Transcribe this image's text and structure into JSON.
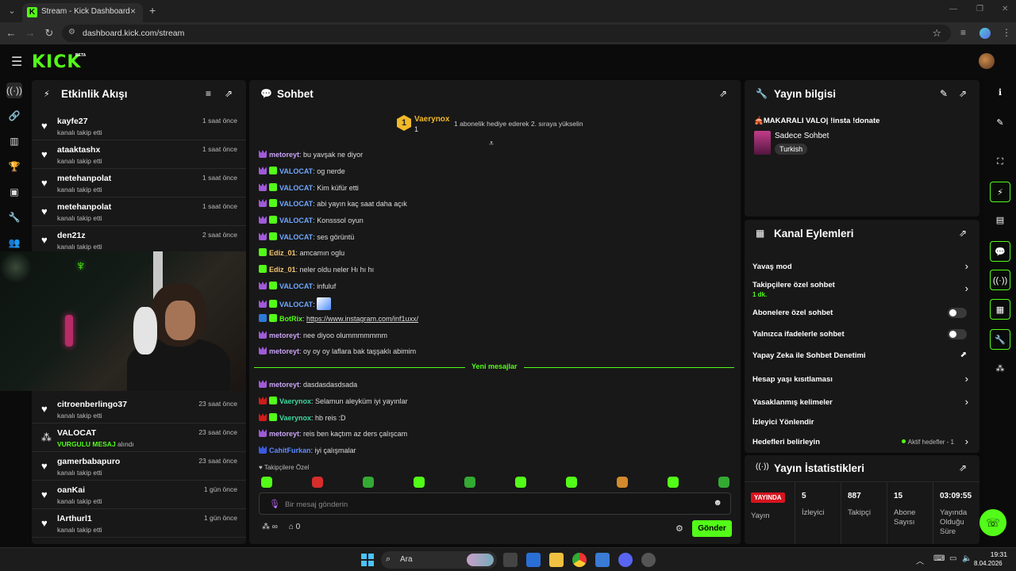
{
  "browser": {
    "tab_title": "Stream - Kick Dashboard",
    "url": "dashboard.kick.com/stream"
  },
  "header": {
    "logo": "KICK",
    "beta": "BETA"
  },
  "activity": {
    "title": "Etkinlik Akışı",
    "items": [
      {
        "name": "kayfe27",
        "sub": "kanalı takip etti",
        "time": "1 saat önce"
      },
      {
        "name": "ataaktashx",
        "sub": "kanalı takip etti",
        "time": "1 saat önce"
      },
      {
        "name": "metehanpolat",
        "sub": "kanalı takip etti",
        "time": "1 saat önce"
      },
      {
        "name": "metehanpolat",
        "sub": "kanalı takip etti",
        "time": "1 saat önce"
      },
      {
        "name": "den21z",
        "sub": "kanalı takip etti",
        "time": "2 saat önce"
      },
      {
        "name": "citroenberlingo37",
        "sub": "kanalı takip etti",
        "time": "23 saat önce"
      },
      {
        "name": "VALOCAT",
        "sub_highlight": "VURGULU MESAJ",
        "sub_rest": " alındı",
        "time": "23 saat önce"
      },
      {
        "name": "gamerbabapuro",
        "sub": "kanalı takip etti",
        "time": "23 saat önce"
      },
      {
        "name": "oanKai",
        "sub": "kanalı takip etti",
        "time": "1 gün önce"
      },
      {
        "name": "lArthurl1",
        "sub": "kanalı takip etti",
        "time": "1 gün önce"
      }
    ]
  },
  "chat": {
    "title": "Sohbet",
    "pinned": {
      "rank": "1",
      "name": "Vaerynox",
      "count": "1",
      "message": "1 abonelik hediye ederek 2. sıraya yükselin"
    },
    "messages": [
      {
        "user": "metoreyt",
        "text": "bu yavşak ne diyor",
        "color": "#c9a3f5",
        "badges": [
          "purple"
        ]
      },
      {
        "user": "VALOCAT",
        "text": "og nerde",
        "color": "#6fa8ff",
        "badges": [
          "purple",
          "green"
        ]
      },
      {
        "user": "VALOCAT",
        "text": "Kim küfür etti",
        "color": "#6fa8ff",
        "badges": [
          "purple",
          "green"
        ]
      },
      {
        "user": "VALOCAT",
        "text": "abi yayın kaç saat daha açık",
        "color": "#6fa8ff",
        "badges": [
          "purple",
          "green"
        ]
      },
      {
        "user": "VALOCAT",
        "text": "Konsssol oyun",
        "color": "#6fa8ff",
        "badges": [
          "purple",
          "green"
        ]
      },
      {
        "user": "VALOCAT",
        "text": "ses görüntü",
        "color": "#6fa8ff",
        "badges": [
          "purple",
          "green"
        ]
      },
      {
        "user": "Ediz_01",
        "text": "amcamın oglu",
        "color": "#f5c66f",
        "badges": [
          "green"
        ]
      },
      {
        "user": "Ediz_01",
        "text": "neler oldu neler Hı hı hı",
        "color": "#f5c66f",
        "badges": [
          "green"
        ]
      },
      {
        "user": "VALOCAT",
        "text": "infuluf",
        "color": "#6fa8ff",
        "badges": [
          "purple",
          "green"
        ]
      },
      {
        "user": "VALOCAT",
        "text": "",
        "color": "#6fa8ff",
        "badges": [
          "purple",
          "green"
        ]
      },
      {
        "user": "BotRix",
        "text": "",
        "link": "https://www.instagram.com/inf1uxx/",
        "color": "#53fc18",
        "badges": [
          "botrix",
          "green"
        ]
      },
      {
        "user": "metoreyt",
        "text": "nee diyoo olummmmmmm",
        "color": "#c9a3f5",
        "badges": [
          "purple"
        ]
      },
      {
        "user": "metoreyt",
        "text": "oy oy oy laflara bak taşşaklı abimim",
        "color": "#c9a3f5",
        "badges": [
          "purple"
        ]
      },
      {
        "user": "metoreyt",
        "text": "dasdasdasdsada",
        "color": "#c9a3f5",
        "badges": [
          "purple"
        ]
      },
      {
        "user": "Vaerynox",
        "text": "Selamun aleyküm iyi yayınlar",
        "color": "#3fd8a0",
        "badges": [
          "red",
          "green"
        ]
      },
      {
        "user": "Vaerynox",
        "text": "hb reis :D",
        "color": "#3fd8a0",
        "badges": [
          "red",
          "green"
        ]
      },
      {
        "user": "metoreyt",
        "text": "reis ben kaçtım az ders çalışcam",
        "color": "#c9a3f5",
        "badges": [
          "purple"
        ]
      },
      {
        "user": "CahitFurkan",
        "text": "iyi çalışmalar",
        "color": "#5b8cff",
        "badges": [
          "blue"
        ]
      }
    ],
    "new_messages_label": "Yeni mesajlar",
    "followers_only": "Takipçilere Özel",
    "input_placeholder": "Bir mesaj gönderin",
    "points_label": "∞",
    "store_count": "0",
    "send_label": "Gönder"
  },
  "stream_info": {
    "title": "Yayın bilgisi",
    "stream_title": "🎪MAKARALI VALO| !insta !donate",
    "category": "Sadece Sohbet",
    "tag": "Turkish"
  },
  "channel_actions": {
    "title": "Kanal Eylemleri",
    "slow_mode": "Yavaş mod",
    "followers_chat": "Takipçilere özel sohbet",
    "followers_chat_sub": "1 dk.",
    "subscribers_chat": "Abonelere özel sohbet",
    "emotes_chat": "Yalnızca ifadelerle sohbet",
    "ai_moderation": "Yapay Zeka ile Sohbet Denetimi",
    "age_restriction": "Hesap yaşı kısıtlaması",
    "banned_words": "Yasaklanmış kelimeler",
    "redirect": "İzleyici Yönlendir",
    "goals": "Hedefleri belirleyin",
    "goals_status": "Aktif hedefler - 1"
  },
  "stats": {
    "title": "Yayın İstatistikleri",
    "live": "YAYINDA",
    "live_label": "Yayın",
    "viewers": "5",
    "viewers_label": "İzleyici",
    "followers": "887",
    "followers_label": "Takipçi",
    "subs": "15",
    "subs_label": "Abone Sayısı",
    "duration": "03:09:55",
    "duration_label": "Yayında Olduğu Süre"
  },
  "taskbar": {
    "search": "Ara",
    "time": "19:31",
    "date": "8.04.2026"
  },
  "colors": {
    "accent": "#53fc18",
    "live": "#d6141e",
    "panel": "#181818"
  }
}
